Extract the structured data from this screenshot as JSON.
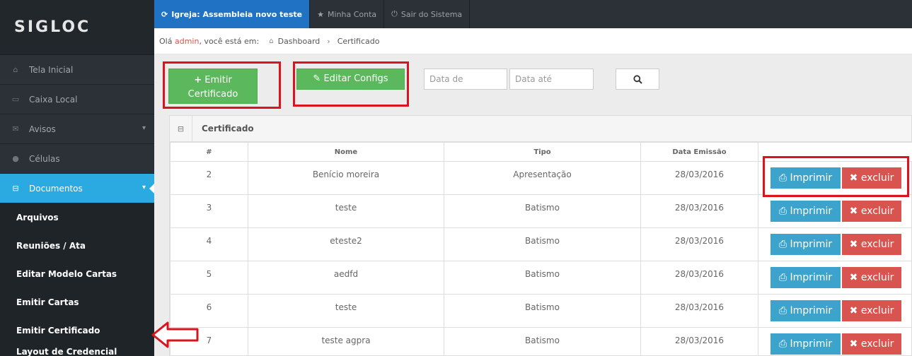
{
  "logo": "SIGLOC",
  "topbar": {
    "church_prefix": "Igreja:",
    "church_name": "Assembleia novo teste",
    "account": "Minha Conta",
    "logout": "Sair do Sistema"
  },
  "breadcrumb": {
    "greeting": "Olá",
    "user": "admin",
    "suffix": ", você está em:",
    "home": "Dashboard",
    "current": "Certificado"
  },
  "sidebar": {
    "items": [
      {
        "label": "Tela Inicial",
        "icon": "home-icon"
      },
      {
        "label": "Caixa Local",
        "icon": "money-icon"
      },
      {
        "label": "Avisos",
        "icon": "envelope-icon"
      },
      {
        "label": "Células",
        "icon": "users-icon"
      },
      {
        "label": "Documentos",
        "icon": "inbox-icon"
      }
    ],
    "subitems": [
      "Arquivos",
      "Reuniões / Ata",
      "Editar Modelo Cartas",
      "Emitir Cartas",
      "Emitir Certificado",
      "Layout de Credencial"
    ]
  },
  "toolbar": {
    "emit_line1": "Emitir",
    "emit_line2": "Certificado",
    "edit_label": "Editar Configs",
    "date_from_placeholder": "Data de",
    "date_to_placeholder": "Data até"
  },
  "panel": {
    "title": "Certificado",
    "columns": [
      "#",
      "Nome",
      "Tipo",
      "Data Emissão",
      ""
    ],
    "print_label": "Imprimir",
    "delete_label": "excluir",
    "rows": [
      {
        "id": "2",
        "name": "Benício moreira",
        "type": "Apresentação",
        "date": "28/03/2016"
      },
      {
        "id": "3",
        "name": "teste",
        "type": "Batismo",
        "date": "28/03/2016"
      },
      {
        "id": "4",
        "name": "eteste2",
        "type": "Batismo",
        "date": "28/03/2016"
      },
      {
        "id": "5",
        "name": "aedfd",
        "type": "Batismo",
        "date": "28/03/2016"
      },
      {
        "id": "6",
        "name": "teste",
        "type": "Batismo",
        "date": "28/03/2016"
      },
      {
        "id": "7",
        "name": "teste agpra",
        "type": "Batismo",
        "date": "28/03/2016"
      }
    ]
  },
  "colors": {
    "sidebar": "#2b3137",
    "active": "#2ba9e1",
    "green": "#5cb85c",
    "blue": "#3ca4cc",
    "red": "#d9534f",
    "highlight": "#d9141e"
  }
}
